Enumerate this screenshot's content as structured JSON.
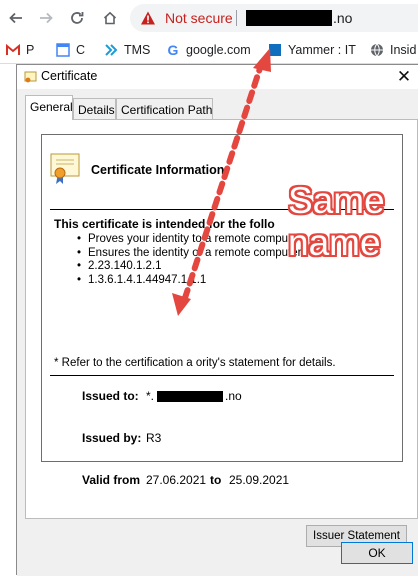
{
  "browser": {
    "security_label": "Not secure",
    "url_suffix": ".no",
    "bookmarks": [
      {
        "label": "P",
        "icon": "gmail-icon"
      },
      {
        "label": "C",
        "icon": "calendar-icon"
      },
      {
        "label": "TMS",
        "icon": "tms-icon"
      },
      {
        "label": "google.com",
        "icon": "google-icon"
      },
      {
        "label": "Yammer : IT",
        "icon": "yammer-icon"
      },
      {
        "label": "Insid",
        "icon": "globe-icon"
      }
    ]
  },
  "dialog": {
    "title": "Certificate",
    "tabs": [
      {
        "label": "General",
        "active": true
      },
      {
        "label": "Details",
        "active": false
      },
      {
        "label": "Certification Path",
        "active": false
      }
    ],
    "info_heading": "Certificate Information",
    "intended_title": "This certificate is intended for the follo",
    "purposes": [
      "Proves your identity to a remote compu",
      "Ensures the identity of a remote computer",
      "2.23.140.1.2.1",
      "1.3.6.1.4.1.44947.1.1.1"
    ],
    "refer_text": "* Refer to the certification a   ority's statement for details.",
    "issued_to_label": "Issued to:",
    "issued_to_prefix": "*.",
    "issued_to_suffix": ".no",
    "issued_by_label": "Issued by:",
    "issued_by_value": "R3",
    "valid_from_label": "Valid from",
    "valid_from_value": "27.06.2021",
    "valid_to_word": "to",
    "valid_to_value": "25.09.2021",
    "issuer_statement_button": "Issuer Statement",
    "ok_button": "OK"
  },
  "annotation": {
    "line1": "Same",
    "line2": "name",
    "color": "#e4473f"
  }
}
